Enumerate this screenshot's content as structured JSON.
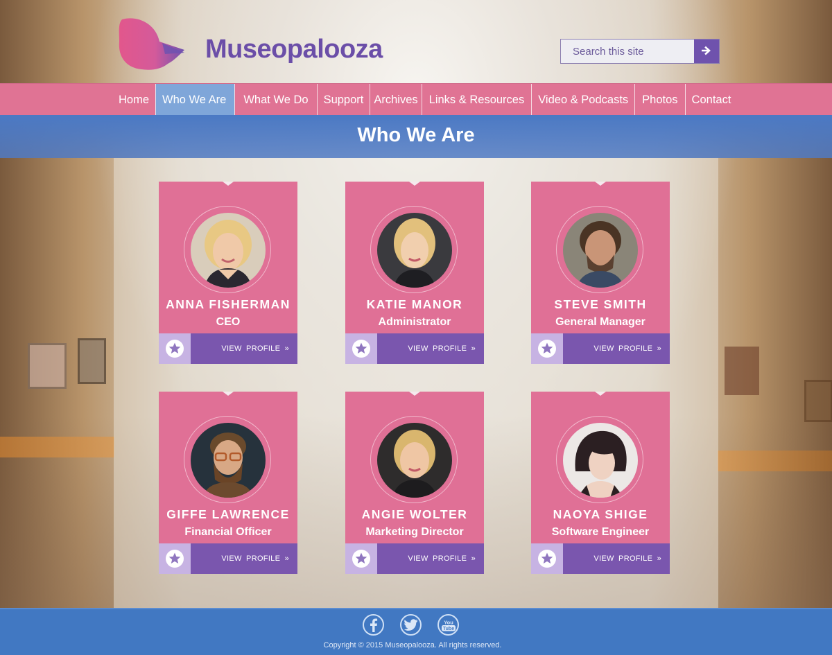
{
  "header": {
    "site_name": "Museopalooza",
    "search_placeholder": "Search this site"
  },
  "nav": {
    "items": [
      "Home",
      "Who We Are",
      "What We Do",
      "Support",
      "Archives",
      "Links & Resources",
      "Video & Podcasts",
      "Photos",
      "Contact"
    ],
    "active": "Who We Are"
  },
  "banner": {
    "title": "Who We Are"
  },
  "cards": [
    {
      "name": "ANNA FISHERMAN",
      "role": "CEO",
      "link": "VIEW PROFILE »"
    },
    {
      "name": "KATIE MANOR",
      "role": "Administrator",
      "link": "VIEW PROFILE »"
    },
    {
      "name": "STEVE SMITH",
      "role": "General Manager",
      "link": "VIEW PROFILE »"
    },
    {
      "name": "GIFFE LAWRENCE",
      "role": "Financial Officer",
      "link": "VIEW PROFILE »"
    },
    {
      "name": "ANGIE WOLTER",
      "role": "Marketing Director",
      "link": "VIEW PROFILE »"
    },
    {
      "name": "NAOYA SHIGE",
      "role": "Software Engineer",
      "link": "VIEW PROFILE »"
    }
  ],
  "footer": {
    "social": [
      "facebook-icon",
      "twitter-icon",
      "youtube-icon"
    ],
    "youtube_label_1": "You",
    "youtube_label_2": "Tube",
    "copyright": "Copyright © 2015 Museopalooza. All rights reserved."
  },
  "colors": {
    "nav_pink": "#e07394",
    "card_pink": "#e07096",
    "purple": "#7a56ae",
    "lavender": "#c7b3e3",
    "banner_blue": "#4b79c4",
    "footer_blue": "#4178c2",
    "active_nav": "#7fa6d9"
  }
}
